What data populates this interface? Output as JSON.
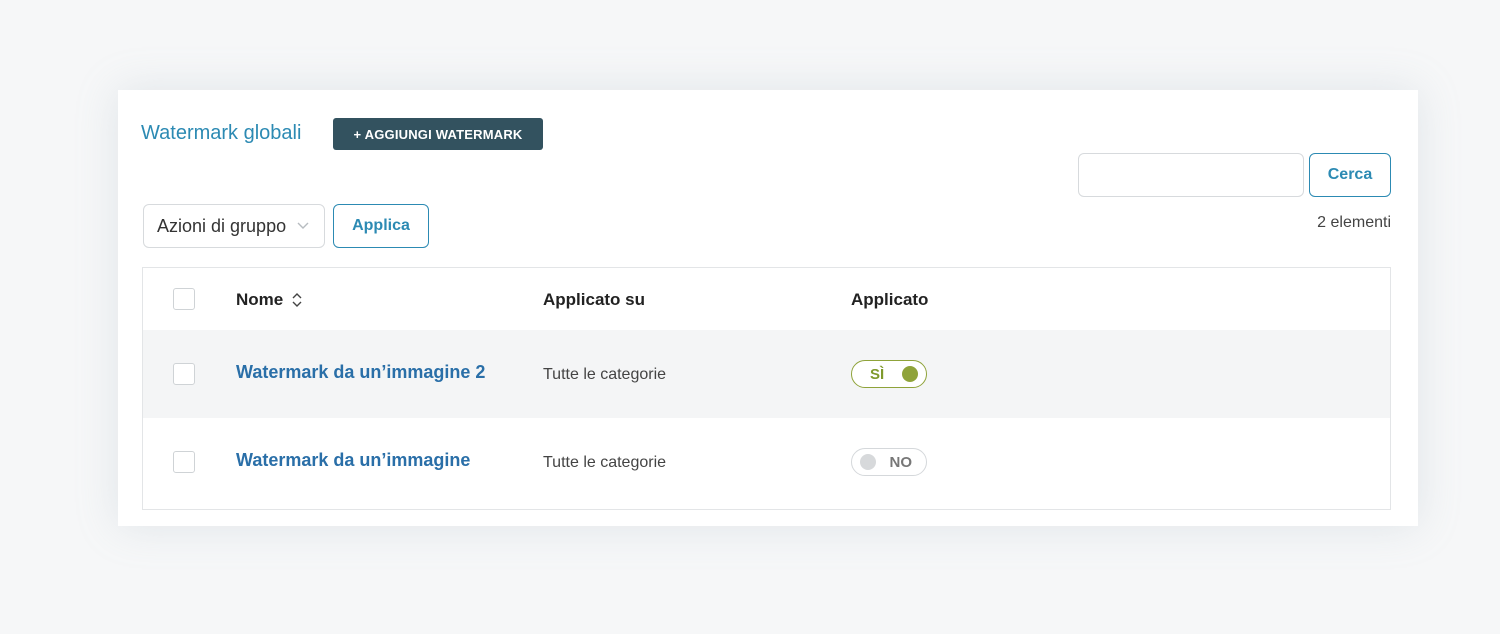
{
  "header": {
    "title": "Watermark globali",
    "add_button_label": "+ AGGIUNGI WATERMARK"
  },
  "search": {
    "value": "",
    "button_label": "Cerca"
  },
  "count_label": "2 elementi",
  "bulk_actions": {
    "selected": "Azioni di gruppo",
    "apply_label": "Applica"
  },
  "table": {
    "columns": [
      "Nome",
      "Applicato su",
      "Applicato"
    ],
    "rows": [
      {
        "name": "Watermark da un’immagine 2",
        "applied_on": "Tutte le categorie",
        "applied": "SÌ",
        "applied_state": true
      },
      {
        "name": "Watermark da un’immagine",
        "applied_on": "Tutte le categorie",
        "applied": "NO",
        "applied_state": false
      }
    ]
  },
  "colors": {
    "title": "#2c8ab3",
    "primary_button": "#33525f",
    "link": "#2a6fa8",
    "toggle_on": "#8fa33a",
    "toggle_off": "#d7d9db"
  },
  "icons": {
    "sort": "sort-icon",
    "dropdown": "chevron-down-icon"
  }
}
